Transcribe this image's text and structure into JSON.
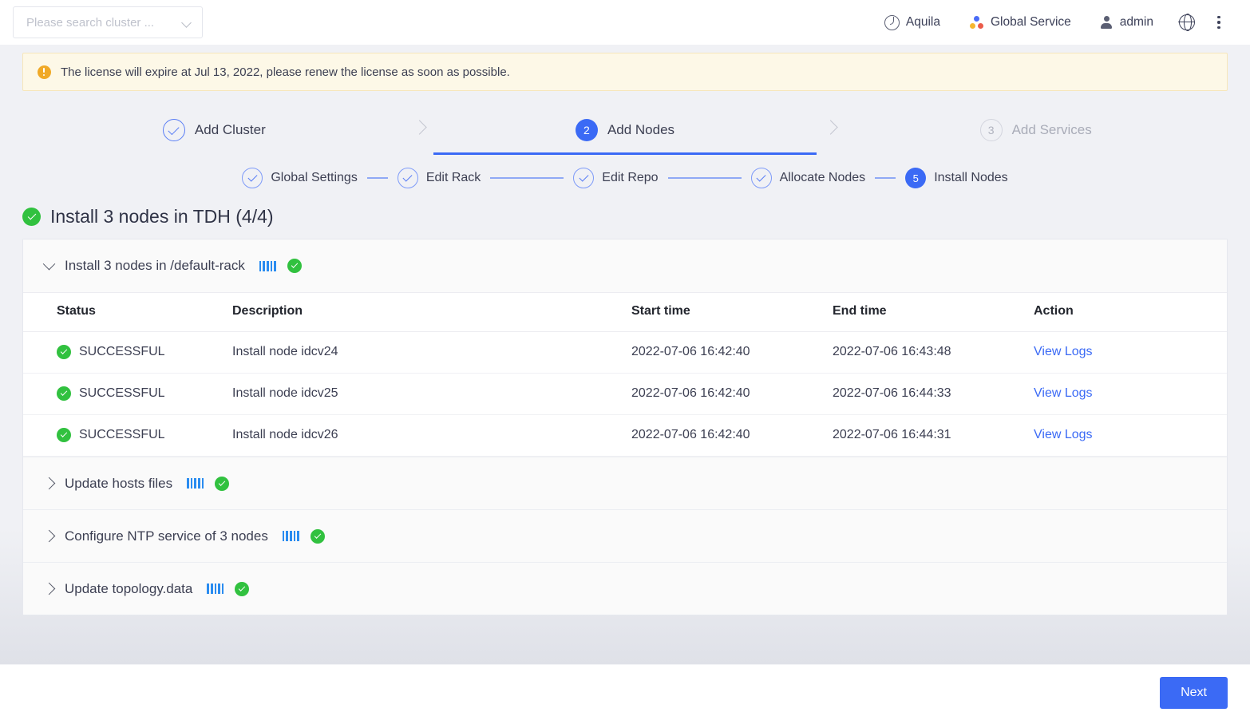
{
  "header": {
    "cluster_search_placeholder": "Please search cluster ...",
    "items": [
      {
        "icon": "aquila-icon",
        "label": "Aquila"
      },
      {
        "icon": "global-service-icon",
        "label": "Global Service"
      },
      {
        "icon": "user-icon",
        "label": "admin"
      }
    ],
    "language_icon": "globe-icon",
    "more_icon": "kebab-menu-icon"
  },
  "banner": {
    "icon": "warning-icon",
    "text": "The license will expire at Jul 13, 2022, please renew the license as soon as possible."
  },
  "stepper": {
    "steps": [
      {
        "badge": "✓",
        "label": "Add Cluster",
        "state": "done"
      },
      {
        "badge": "2",
        "label": "Add Nodes",
        "state": "active"
      },
      {
        "badge": "3",
        "label": "Add Services",
        "state": "todo"
      }
    ]
  },
  "substepper": {
    "steps": [
      {
        "badge": "✓",
        "label": "Global Settings",
        "state": "done"
      },
      {
        "badge": "✓",
        "label": "Edit Rack",
        "state": "done"
      },
      {
        "badge": "✓",
        "label": "Edit Repo",
        "state": "done"
      },
      {
        "badge": "✓",
        "label": "Allocate Nodes",
        "state": "done"
      },
      {
        "badge": "5",
        "label": "Install Nodes",
        "state": "active"
      }
    ]
  },
  "section": {
    "status_icon": "success-check-icon",
    "title": "Install 3 nodes in TDH (4/4)"
  },
  "panel": {
    "expanded_group": {
      "chevron": "chevron-down-icon",
      "title": "Install 3 nodes in /default-rack",
      "progress_icon": "progress-bars-icon",
      "status_icon": "success-check-icon"
    },
    "columns": [
      "Status",
      "Description",
      "Start time",
      "End time",
      "Action"
    ],
    "rows": [
      {
        "status": "SUCCESSFUL",
        "description": "Install node idcv24",
        "start_time": "2022-07-06 16:42:40",
        "end_time": "2022-07-06 16:43:48",
        "action": "View Logs"
      },
      {
        "status": "SUCCESSFUL",
        "description": "Install node idcv25",
        "start_time": "2022-07-06 16:42:40",
        "end_time": "2022-07-06 16:44:33",
        "action": "View Logs"
      },
      {
        "status": "SUCCESSFUL",
        "description": "Install node idcv26",
        "start_time": "2022-07-06 16:42:40",
        "end_time": "2022-07-06 16:44:31",
        "action": "View Logs"
      }
    ],
    "collapsed_groups": [
      {
        "chevron": "chevron-right-icon",
        "title": "Update hosts files",
        "progress_icon": "progress-bars-icon",
        "status_icon": "success-check-icon"
      },
      {
        "chevron": "chevron-right-icon",
        "title": "Configure NTP service of 3 nodes",
        "progress_icon": "progress-bars-icon",
        "status_icon": "success-check-icon"
      },
      {
        "chevron": "chevron-right-icon",
        "title": "Update topology.data",
        "progress_icon": "progress-bars-icon",
        "status_icon": "success-check-icon"
      }
    ]
  },
  "footer": {
    "next_label": "Next"
  },
  "colors": {
    "accent_blue": "#3b6af5",
    "success_green": "#31c13f",
    "warning_yellow": "#f0a927",
    "progress_blue": "#2a8cf0",
    "page_bg": "#f0f1f5"
  }
}
